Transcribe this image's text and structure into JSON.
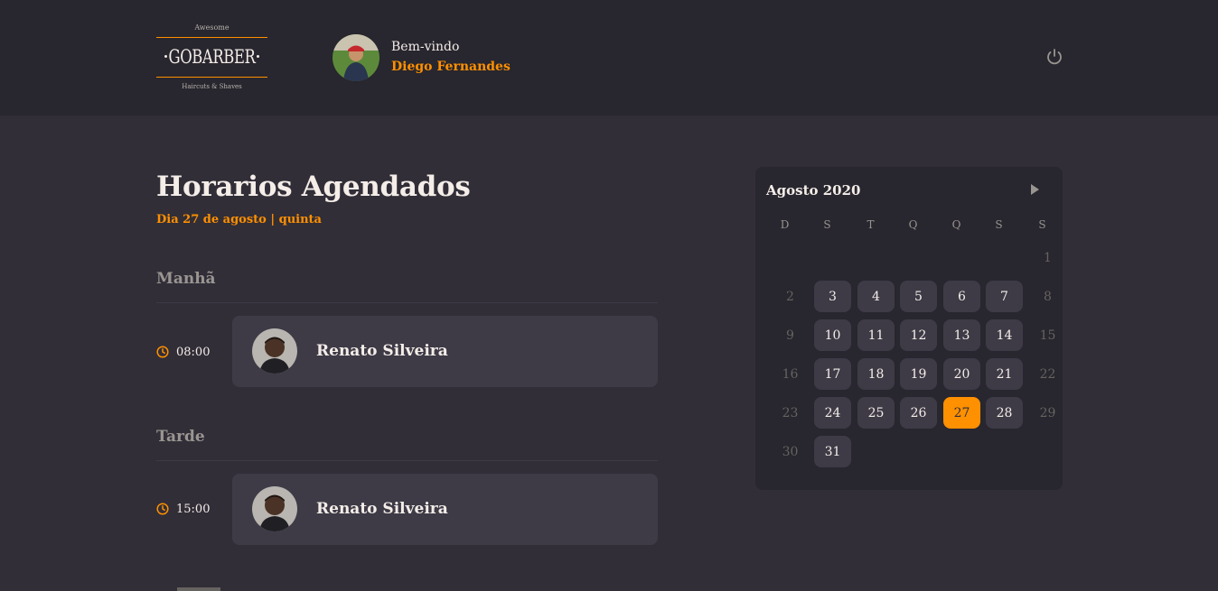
{
  "header": {
    "logo": {
      "top_tag": "Awesome",
      "brand": "GOBARBER",
      "bottom_tag": "Haircuts & Shaves"
    },
    "welcome": "Bem-vindo",
    "user_name": "Diego Fernandes",
    "icon": "power-icon"
  },
  "schedule": {
    "title": "Horarios Agendados",
    "subtitle": "Dia 27 de agosto | quinta",
    "sections": [
      {
        "title": "Manhã",
        "appointments": [
          {
            "time": "08:00",
            "provider": "Renato Silveira"
          }
        ]
      },
      {
        "title": "Tarde",
        "appointments": [
          {
            "time": "15:00",
            "provider": "Renato Silveira"
          }
        ]
      }
    ]
  },
  "calendar": {
    "caption": "Agosto 2020",
    "weekdays": [
      "D",
      "S",
      "T",
      "Q",
      "Q",
      "S",
      "S"
    ],
    "days": [
      "1",
      "2",
      "3",
      "4",
      "5",
      "6",
      "7",
      "8",
      "9",
      "10",
      "11",
      "12",
      "13",
      "14",
      "15",
      "16",
      "17",
      "18",
      "19",
      "20",
      "21",
      "22",
      "23",
      "24",
      "25",
      "26",
      "27",
      "28",
      "29",
      "30",
      "31"
    ],
    "selected_day": "27",
    "disabled_days": [
      "1",
      "2",
      "8",
      "9",
      "15",
      "16",
      "22",
      "23",
      "29",
      "30"
    ],
    "next_icon": "play-right-icon"
  },
  "colors": {
    "accent": "#ff9000",
    "background": "#312e38",
    "header": "#28262e",
    "card": "#3e3b47"
  }
}
